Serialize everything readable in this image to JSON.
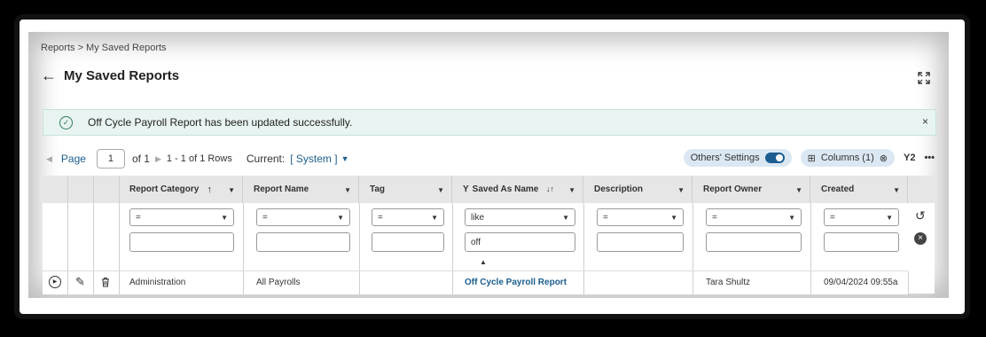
{
  "breadcrumb": "Reports > My Saved Reports",
  "page_title": "My Saved Reports",
  "toast": {
    "message": "Off Cycle Payroll Report has been updated successfully.",
    "close": "×"
  },
  "pager": {
    "page_label": "Page",
    "page_value": "1",
    "of": "of 1",
    "rows": "1 - 1 of 1 Rows",
    "current_label": "Current:",
    "current_value": "[ System ]"
  },
  "tools": {
    "others_settings": "Others' Settings",
    "columns": "Columns (1)",
    "filter_count": "2",
    "more": "•••"
  },
  "columns": [
    {
      "label": "Report Category",
      "sort": "↑",
      "filter_op": "=",
      "filter_val": ""
    },
    {
      "label": "Report Name",
      "filter_op": "=",
      "filter_val": ""
    },
    {
      "label": "Tag",
      "filter_op": "=",
      "filter_val": ""
    },
    {
      "label": "Saved As Name",
      "sort": "↓↑",
      "filter_op": "like",
      "filter_val": "off"
    },
    {
      "label": "Description",
      "filter_op": "=",
      "filter_val": ""
    },
    {
      "label": "Report Owner",
      "filter_op": "=",
      "filter_val": ""
    },
    {
      "label": "Created",
      "filter_op": "=",
      "filter_val": ""
    }
  ],
  "rows": [
    {
      "category": "Administration",
      "name": "All Payrolls",
      "tag": "",
      "saved_as": "Off Cycle Payroll Report",
      "description": "",
      "owner": "Tara Shultz",
      "created": "09/04/2024 09:55a"
    }
  ]
}
